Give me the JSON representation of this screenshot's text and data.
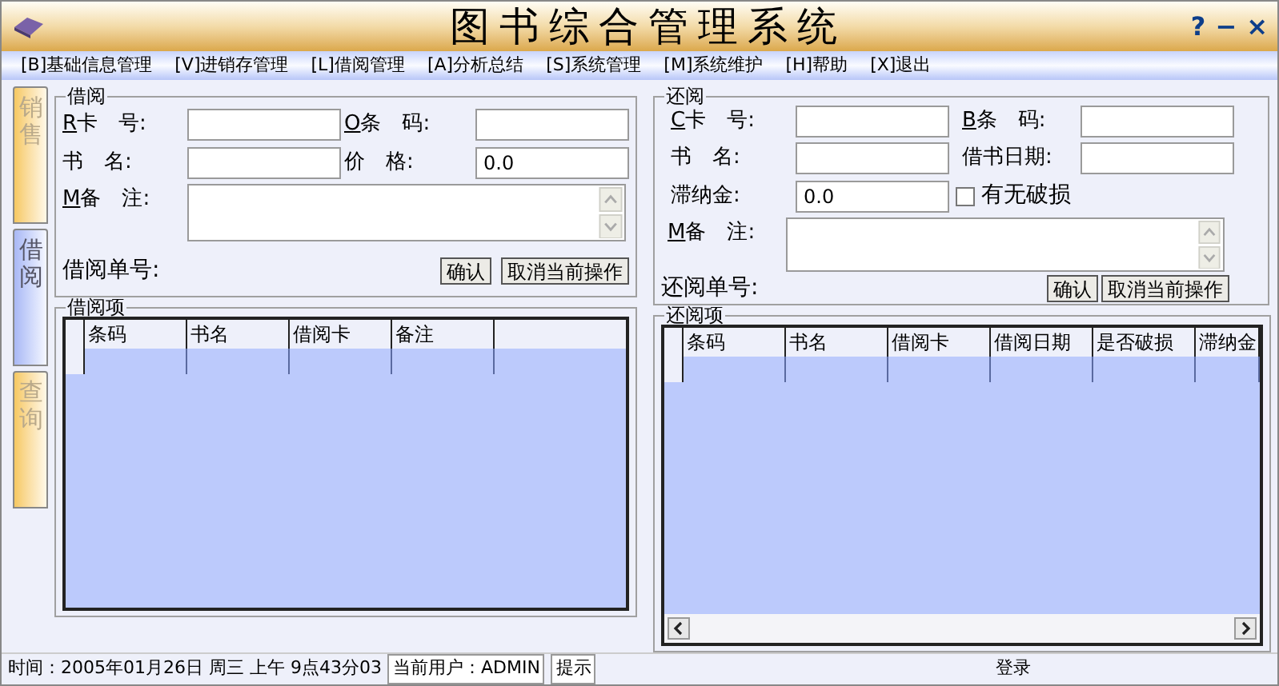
{
  "window": {
    "title": "图书综合管理系统",
    "controls": [
      "?",
      "−",
      "×"
    ]
  },
  "menu": [
    "[B]基础信息管理",
    "[V]进销存管理",
    "[L]借阅管理",
    "[A]分析总结",
    "[S]系统管理",
    "[M]系统维护",
    "[H]帮助",
    "[X]退出"
  ],
  "side_tabs": [
    {
      "label": "销售",
      "selected": false
    },
    {
      "label": "借阅",
      "selected": true
    },
    {
      "label": "查询",
      "selected": false
    }
  ],
  "borrow": {
    "title": "借阅",
    "fields": [
      {
        "key": "R",
        "label": "卡　号:"
      },
      {
        "key": "O",
        "label": "条　码:"
      },
      {
        "label": "书　名:"
      },
      {
        "label": "价　格:",
        "value": "0.0"
      }
    ],
    "note": {
      "key": "M",
      "label": "备　注:"
    },
    "order_label": "借阅单号:",
    "buttons": [
      "确认",
      "取消当前操作"
    ],
    "items_title": "借阅项",
    "columns": [
      "条码",
      "书名",
      "借阅卡",
      "备注"
    ]
  },
  "return": {
    "title": "还阅",
    "fields": [
      {
        "key": "C",
        "label": "卡　号:"
      },
      {
        "key": "B",
        "label": "条　码:"
      },
      {
        "label": "书　名:"
      },
      {
        "label": "借书日期:"
      },
      {
        "label": "滞纳金:",
        "value": "0.0"
      }
    ],
    "damaged": {
      "label": "有无破损",
      "checked": false
    },
    "note": {
      "key": "M",
      "label": "备　注:"
    },
    "order_label": "还阅单号:",
    "buttons": [
      "确认",
      "取消当前操作"
    ],
    "items_title": "还阅项",
    "columns": [
      "条码",
      "书名",
      "借阅卡",
      "借阅日期",
      "是否破损",
      "滞纳金"
    ]
  },
  "status_bar": [
    "时间：2005年01月26日 周三 上午 9点43分03",
    "当前用户：ADMIN",
    "提示",
    "登录"
  ]
}
